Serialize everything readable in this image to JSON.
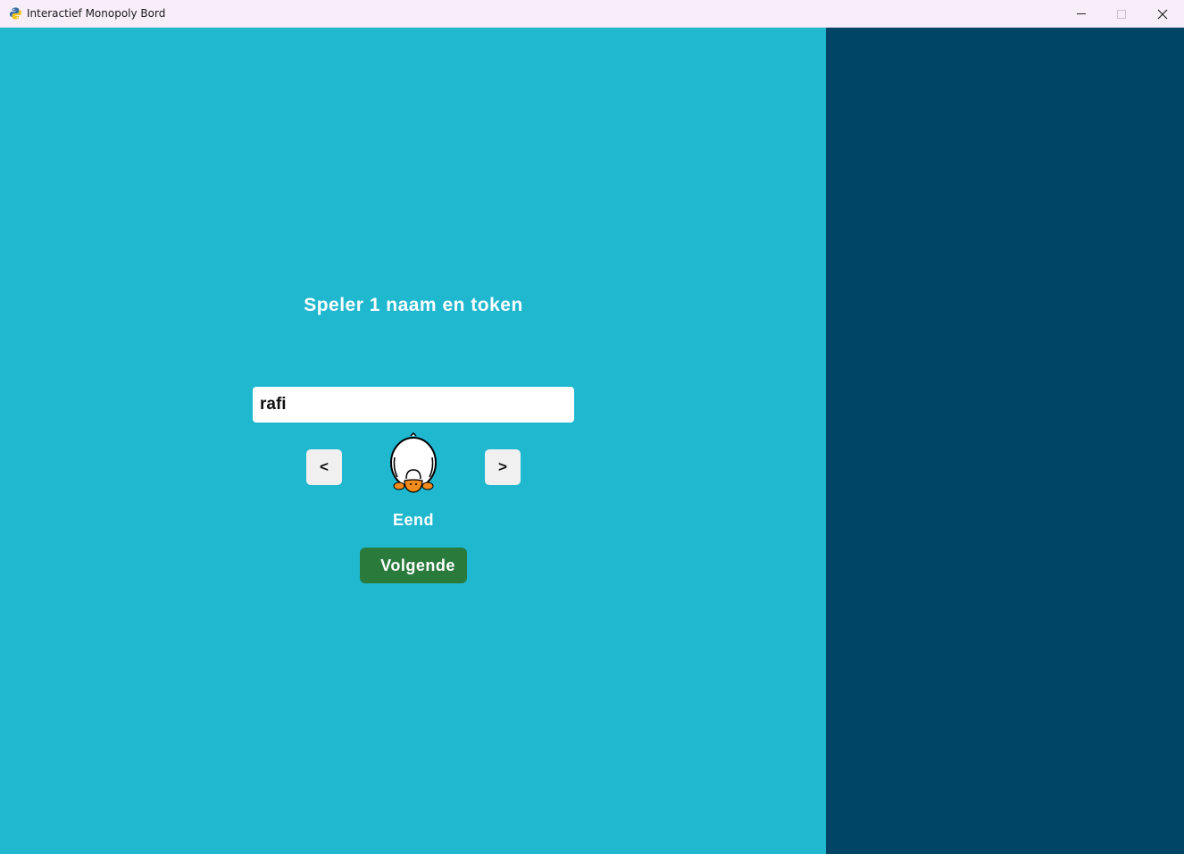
{
  "window": {
    "title": "Interactief Monopoly Bord",
    "icon": "python-icon"
  },
  "setup": {
    "heading": "Speler 1 naam en token",
    "name_value": "rafi",
    "prev_label": "<",
    "next_label": ">",
    "token_icon": "duck-icon",
    "token_name": "Eend",
    "continue_label": "Volgende"
  },
  "colors": {
    "board_bg": "#1fb8cf",
    "side_panel_bg": "#004466",
    "continue_button": "#2a7a3c",
    "duck_bill": "#f08a1c"
  }
}
